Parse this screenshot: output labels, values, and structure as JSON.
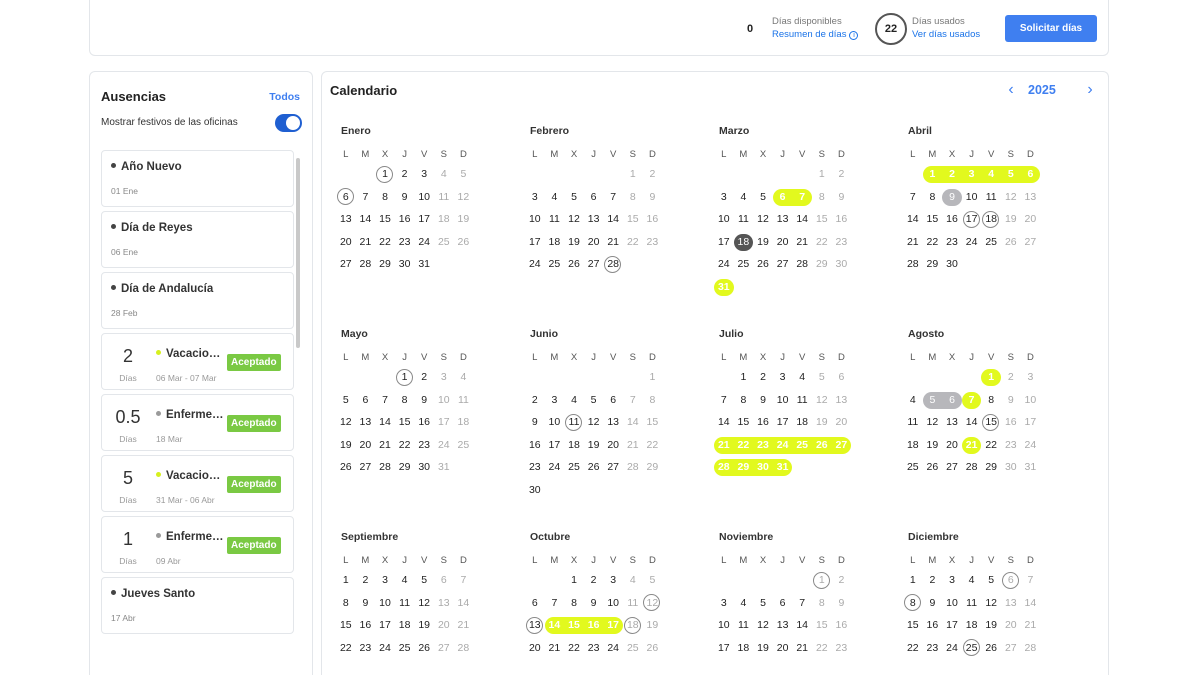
{
  "topbar": {
    "available_count": "0",
    "available_label": "Días disponibles",
    "summary_link": "Resumen de días",
    "used_count": "22",
    "used_label": "Días usados",
    "used_link": "Ver días usados",
    "request_button": "Solicitar días"
  },
  "colors": {
    "accent": "#3f7ff0",
    "highlight": "#e2f91e",
    "accepted": "#7ac943",
    "grey": "#b7b7bb"
  },
  "absences": {
    "title": "Ausencias",
    "filter_all": "Todos",
    "toggle_label": "Mostrar festivos de las oficinas",
    "toggle_on": true,
    "items": [
      {
        "kind": "holiday",
        "name": "Año Nuevo",
        "date": "01 Ene"
      },
      {
        "kind": "holiday",
        "name": "Día de Reyes",
        "date": "06 Ene"
      },
      {
        "kind": "holiday",
        "name": "Día de Andalucía",
        "date": "28 Feb"
      },
      {
        "kind": "absence",
        "amount": "2",
        "unit": "Días",
        "name": "Vacaciones",
        "dot_color": "#d6f01e",
        "range": "06 Mar - 07 Mar",
        "status": "Aceptado"
      },
      {
        "kind": "absence",
        "amount": "0.5",
        "unit": "Días",
        "name": "Enfermedad",
        "dot_color": "#9a9a9a",
        "range": "18 Mar",
        "status": "Aceptado"
      },
      {
        "kind": "absence",
        "amount": "5",
        "unit": "Días",
        "name": "Vacaciones",
        "dot_color": "#d6f01e",
        "range": "31 Mar - 06 Abr",
        "status": "Aceptado"
      },
      {
        "kind": "absence",
        "amount": "1",
        "unit": "Días",
        "name": "Enfermedad",
        "dot_color": "#9a9a9a",
        "range": "09 Abr",
        "status": "Aceptado"
      },
      {
        "kind": "holiday",
        "name": "Jueves Santo",
        "date": "17 Abr"
      }
    ]
  },
  "calendar": {
    "title": "Calendario",
    "year": "2025",
    "prev_icon": "chevron-left-icon",
    "next_icon": "chevron-right-icon",
    "weekdays": [
      "L",
      "M",
      "X",
      "J",
      "V",
      "S",
      "D"
    ],
    "months": [
      {
        "name": "Enero",
        "offset": 2,
        "days": 31,
        "circle": [
          1,
          6
        ]
      },
      {
        "name": "Febrero",
        "offset": 5,
        "days": 28,
        "circle": [
          28
        ]
      },
      {
        "name": "Marzo",
        "offset": 5,
        "days": 31,
        "highlight": [
          6,
          7,
          31
        ],
        "half": [
          18
        ]
      },
      {
        "name": "Abril",
        "offset": 1,
        "days": 30,
        "highlight": [
          1,
          2,
          3,
          4,
          5,
          6
        ],
        "grey": [
          9
        ],
        "circle": [
          17,
          18
        ]
      },
      {
        "name": "Mayo",
        "offset": 3,
        "days": 31,
        "circle": [
          1
        ]
      },
      {
        "name": "Junio",
        "offset": 6,
        "days": 30,
        "circle": [
          11
        ]
      },
      {
        "name": "Julio",
        "offset": 1,
        "days": 31,
        "highlight": [
          21,
          22,
          23,
          24,
          25,
          26,
          27,
          28,
          29,
          30,
          31
        ]
      },
      {
        "name": "Agosto",
        "offset": 4,
        "days": 31,
        "highlight": [
          1,
          7,
          21
        ],
        "grey": [
          5,
          6
        ],
        "circle": [
          15
        ]
      },
      {
        "name": "Septiembre",
        "offset": 0,
        "days": 30,
        "visible_days": 28
      },
      {
        "name": "Octubre",
        "offset": 2,
        "days": 31,
        "visible_days": 26,
        "highlight": [
          14,
          15,
          16,
          17
        ],
        "circle": [
          12,
          13,
          18
        ]
      },
      {
        "name": "Noviembre",
        "offset": 5,
        "days": 30,
        "visible_days": 23,
        "circle": [
          1
        ]
      },
      {
        "name": "Diciembre",
        "offset": 0,
        "days": 31,
        "visible_days": 28,
        "circle": [
          6,
          8,
          25
        ]
      }
    ]
  }
}
